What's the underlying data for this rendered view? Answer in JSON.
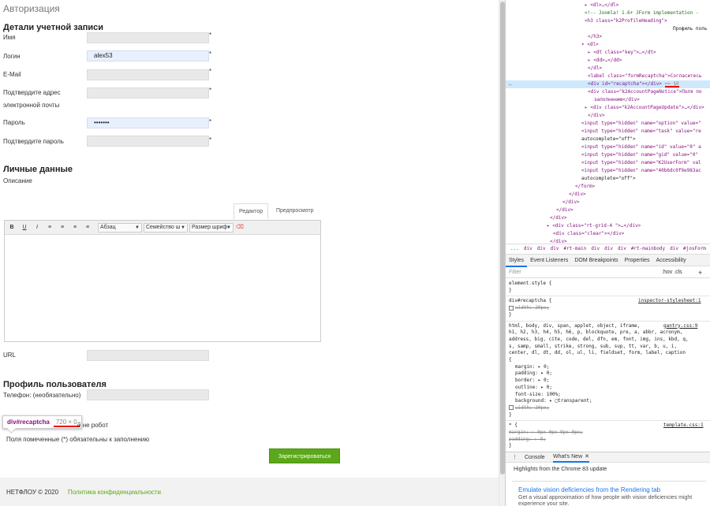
{
  "page": {
    "title": "Авторизация",
    "account_heading": "Детали учетной записи",
    "fields": [
      {
        "label": "Имя",
        "value": "",
        "required": "*"
      },
      {
        "label": "Логин",
        "value": "alex53",
        "required": "*"
      },
      {
        "label": "E-Mail",
        "value": "",
        "required": "*"
      },
      {
        "label": "Подтвердите адрес",
        "label2": "электронной почты",
        "value": "",
        "required": "*"
      },
      {
        "label": "Пароль",
        "value": "•••••••",
        "required": "*"
      },
      {
        "label": "Подтвердите пароль",
        "value": "",
        "required": "*"
      }
    ],
    "personal_heading": "Личные данные",
    "description_label": "Описание",
    "editor": {
      "tab_editor": "Редактор",
      "tab_preview": "Предпросмотр",
      "buttons": [
        "B",
        "U",
        "I",
        "≡",
        "≡",
        "≡",
        "≡"
      ],
      "format_select": "Абзац",
      "family_select": "Семейство ш",
      "size_select": "Размер шриф",
      "clear_icon": "eraser-icon"
    },
    "url_label": "URL",
    "profile_heading": "Профиль пользователя",
    "phone_label": "Телефон: (необязательно)",
    "recaptcha_tip": {
      "selector": "div#recaptcha",
      "dims": "720 × 0"
    },
    "not_robot": "й не робот",
    "required_note": "Поля помеченные (*) обязательны к заполнению",
    "submit": "Зарегистрироваться",
    "footer": {
      "copyright": "НЕТФЛОУ © 2020",
      "privacy": "Политика конфиденциальности"
    }
  },
  "devtools": {
    "elements": [
      {
        "indent": 100,
        "html": "▸ <dl>…</dl>"
      },
      {
        "indent": 100,
        "html": "<!-- Joomla! 1.6+ JForm implementation -"
      },
      {
        "indent": 100,
        "html": "<h3 class=\"k2ProfileHeading\">"
      },
      {
        "indent": 212,
        "html": "Профиль поль"
      },
      {
        "indent": 104,
        "html": "</h3>"
      },
      {
        "indent": 96,
        "html": "▾ <dl>"
      },
      {
        "indent": 104,
        "html": "▸ <dt class=\"key\">…</dt>"
      },
      {
        "indent": 104,
        "html": "▸ <dd>…</dd>"
      },
      {
        "indent": 104,
        "html": "</dl>"
      },
      {
        "indent": 104,
        "html": "<label class=\"formRecaptcha\">Согласитесь"
      },
      {
        "indent": 104,
        "html": "<div id=\"recaptcha\"></div> == $0",
        "highlight": true
      },
      {
        "indent": 104,
        "html": "<div class=\"k2AccountPageNotice\">Поля по"
      },
      {
        "indent": 112,
        "html": "заполнению</div>"
      },
      {
        "indent": 100,
        "html": "▸ <div class=\"k2AccountPageUpdate\">…</div>"
      },
      {
        "indent": 104,
        "html": "</div>"
      },
      {
        "indent": 96,
        "html": "<input type=\"hidden\" name=\"option\" value=\""
      },
      {
        "indent": 96,
        "html": "<input type=\"hidden\" name=\"task\" value=\"re"
      },
      {
        "indent": 96,
        "html": "autocomplete=\"off\">"
      },
      {
        "indent": 96,
        "html": "<input type=\"hidden\" name=\"id\" value=\"0\" a"
      },
      {
        "indent": 96,
        "html": "<input type=\"hidden\" name=\"gid\" value=\"0\""
      },
      {
        "indent": 96,
        "html": "<input type=\"hidden\" name=\"K2UserForm\" val"
      },
      {
        "indent": 96,
        "html": "<input type=\"hidden\" name=\"40b6dc0f9e983ac"
      },
      {
        "indent": 96,
        "html": "autocomplete=\"off\">"
      },
      {
        "indent": 88,
        "html": "</form>"
      },
      {
        "indent": 80,
        "html": "</div>"
      },
      {
        "indent": 72,
        "html": "</div>"
      },
      {
        "indent": 64,
        "html": "</div>"
      },
      {
        "indent": 56,
        "html": "</div>"
      },
      {
        "indent": 52,
        "html": "▸ <div class=\"rt-grid-4 \">…</div>"
      },
      {
        "indent": 60,
        "html": "<div class=\"clear\"></div>"
      },
      {
        "indent": 56,
        "html": "</div>"
      }
    ],
    "breadcrumbs": [
      "...",
      "div",
      "div",
      "div",
      "#rt-main",
      "div",
      "div",
      "div",
      "#rt-mainbody",
      "div",
      "#josForm"
    ],
    "styles_tabs": [
      "Styles",
      "Event Listeners",
      "DOM Breakpoints",
      "Properties",
      "Accessibility"
    ],
    "filter_placeholder": "Filter",
    "filter_hov": ":hov .cls",
    "styles": [
      {
        "t": "element.style {"
      },
      {
        "t": "}"
      },
      {
        "t": "div#recaptcha {",
        "src": "inspector-stylesheet:1"
      },
      {
        "t": "width: 20px;",
        "strike": true,
        "cb": true
      },
      {
        "t": "}"
      },
      {
        "t": "html, body, div, span, applet, object, iframe,",
        "src": "gantry.css:9"
      },
      {
        "t": "h1, h2, h3, h4, h5, h6, p, blockquote, pre, a, abbr, acronym,"
      },
      {
        "t": "address, big, cite, code, del, dfn, em, font, img, ins, kbd, q,"
      },
      {
        "t": "s, samp, small, strike, strong, sub, sup, tt, var, b, u, i,"
      },
      {
        "t": "center, dl, dt, dd, ol, ul, li, fieldset, form, label, caption"
      },
      {
        "t": "{"
      },
      {
        "t": "margin: ▸ 0;",
        "prop": true
      },
      {
        "t": "padding: ▸ 0;",
        "prop": true
      },
      {
        "t": "border: ▸ 0;",
        "prop": true
      },
      {
        "t": "outline: ▸ 0;",
        "prop": true
      },
      {
        "t": "font-size: 100%;",
        "prop": true
      },
      {
        "t": "background: ▸ □transparent;",
        "prop": true
      },
      {
        "t": "width: 20px;",
        "strike": true,
        "cb": true
      },
      {
        "t": "}"
      },
      {
        "t": "* {",
        "src": "template.css:1"
      },
      {
        "t": "margin: ▸ 0px 0px 0px 0px;",
        "strike": true
      },
      {
        "t": "padding: ▸ 0;",
        "strike": true
      },
      {
        "t": "}"
      }
    ],
    "drawer": {
      "tab_console": "Console",
      "tab_whats_new": "What's New",
      "highlights": "Highlights from the Chrome 83 update",
      "card_title": "Emulate vision deficiencies from the Rendering tab",
      "card_text": "Get a visual approximation of how people with vision deficiencies might experience your site."
    }
  }
}
